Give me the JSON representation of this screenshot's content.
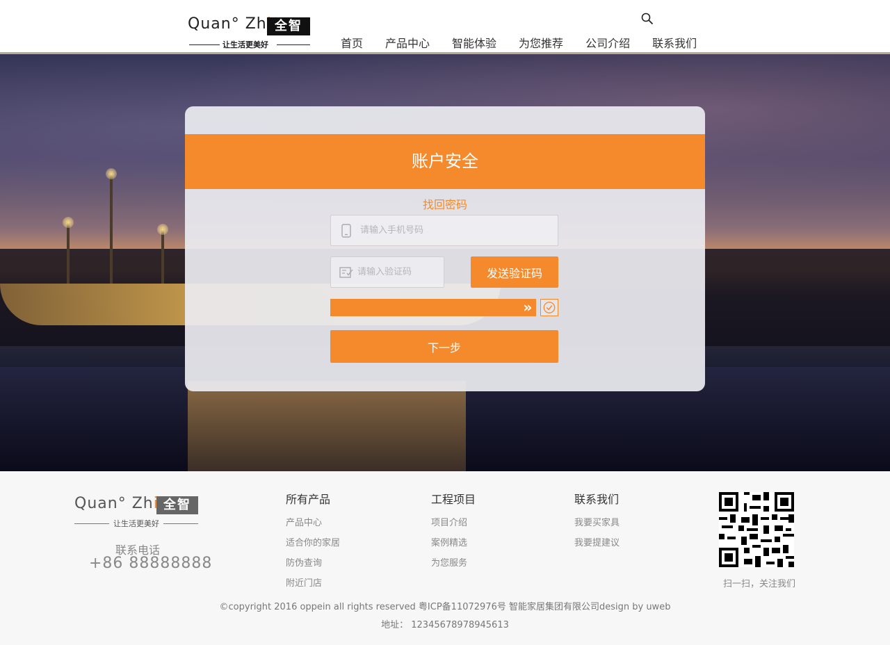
{
  "header": {
    "logo": {
      "brand_prefix": "Quan",
      "brand_mid": "Zh",
      "brand_i": "i",
      "cn": "全智",
      "slogan": "让生活更美好"
    },
    "nav": [
      "首页",
      "产品中心",
      "智能体验",
      "为您推荐",
      "公司介绍",
      "联系我们"
    ]
  },
  "card": {
    "title": "账户安全",
    "subtitle": "找回密码",
    "phone_placeholder": "请输入手机号码",
    "code_placeholder": "请输入验证码",
    "send_code_label": "发送验证码",
    "next_label": "下一步",
    "slider_handle": "»",
    "accent_color": "#f58a2c"
  },
  "footer": {
    "logo": {
      "brand_prefix": "Quan",
      "brand_mid": "Zh",
      "brand_i": "i",
      "cn": "全智",
      "slogan": "让生活更美好"
    },
    "phone_label": "联系电话",
    "phone": "+86  88888888",
    "columns": [
      {
        "title": "所有产品",
        "links": [
          "产品中心",
          "适合你的家居",
          "防伪查询",
          "附近门店"
        ]
      },
      {
        "title": "工程项目",
        "links": [
          "项目介绍",
          "案例精选",
          "为您服务"
        ]
      },
      {
        "title": "联系我们",
        "links": [
          "我要买家具",
          "我要提建议"
        ]
      }
    ],
    "qr_caption": "扫一扫，关注我们",
    "copyright": "©copyright 2016 oppein all rights reserved 粤ICP备11072976号 智能家居集团有限公司design by uweb",
    "address": "地址：  12345678978945613"
  }
}
